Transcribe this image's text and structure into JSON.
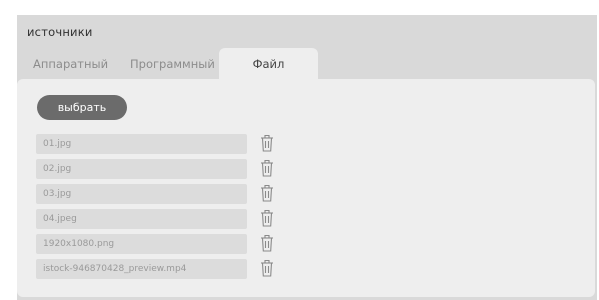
{
  "panel": {
    "title": "источники",
    "tabs": [
      {
        "label": "Аппаратный",
        "active": false
      },
      {
        "label": "Программный",
        "active": false
      },
      {
        "label": "Файл",
        "active": true
      }
    ],
    "select_button": "выбрать",
    "files": [
      {
        "name": "01.jpg",
        "delete_icon": "trash-icon"
      },
      {
        "name": "02.jpg",
        "delete_icon": "trash-icon"
      },
      {
        "name": "03.jpg",
        "delete_icon": "trash-icon"
      },
      {
        "name": "04.jpeg",
        "delete_icon": "trash-icon"
      },
      {
        "name": "1920x1080.png",
        "delete_icon": "trash-icon"
      },
      {
        "name": "istock-946870428_preview.mp4",
        "delete_icon": "trash-icon"
      }
    ]
  },
  "colors": {
    "panel_bg": "#d9d9d9",
    "content_bg": "#eeeeee",
    "button_bg": "#6b6b6b",
    "field_bg": "#dcdcdc"
  }
}
